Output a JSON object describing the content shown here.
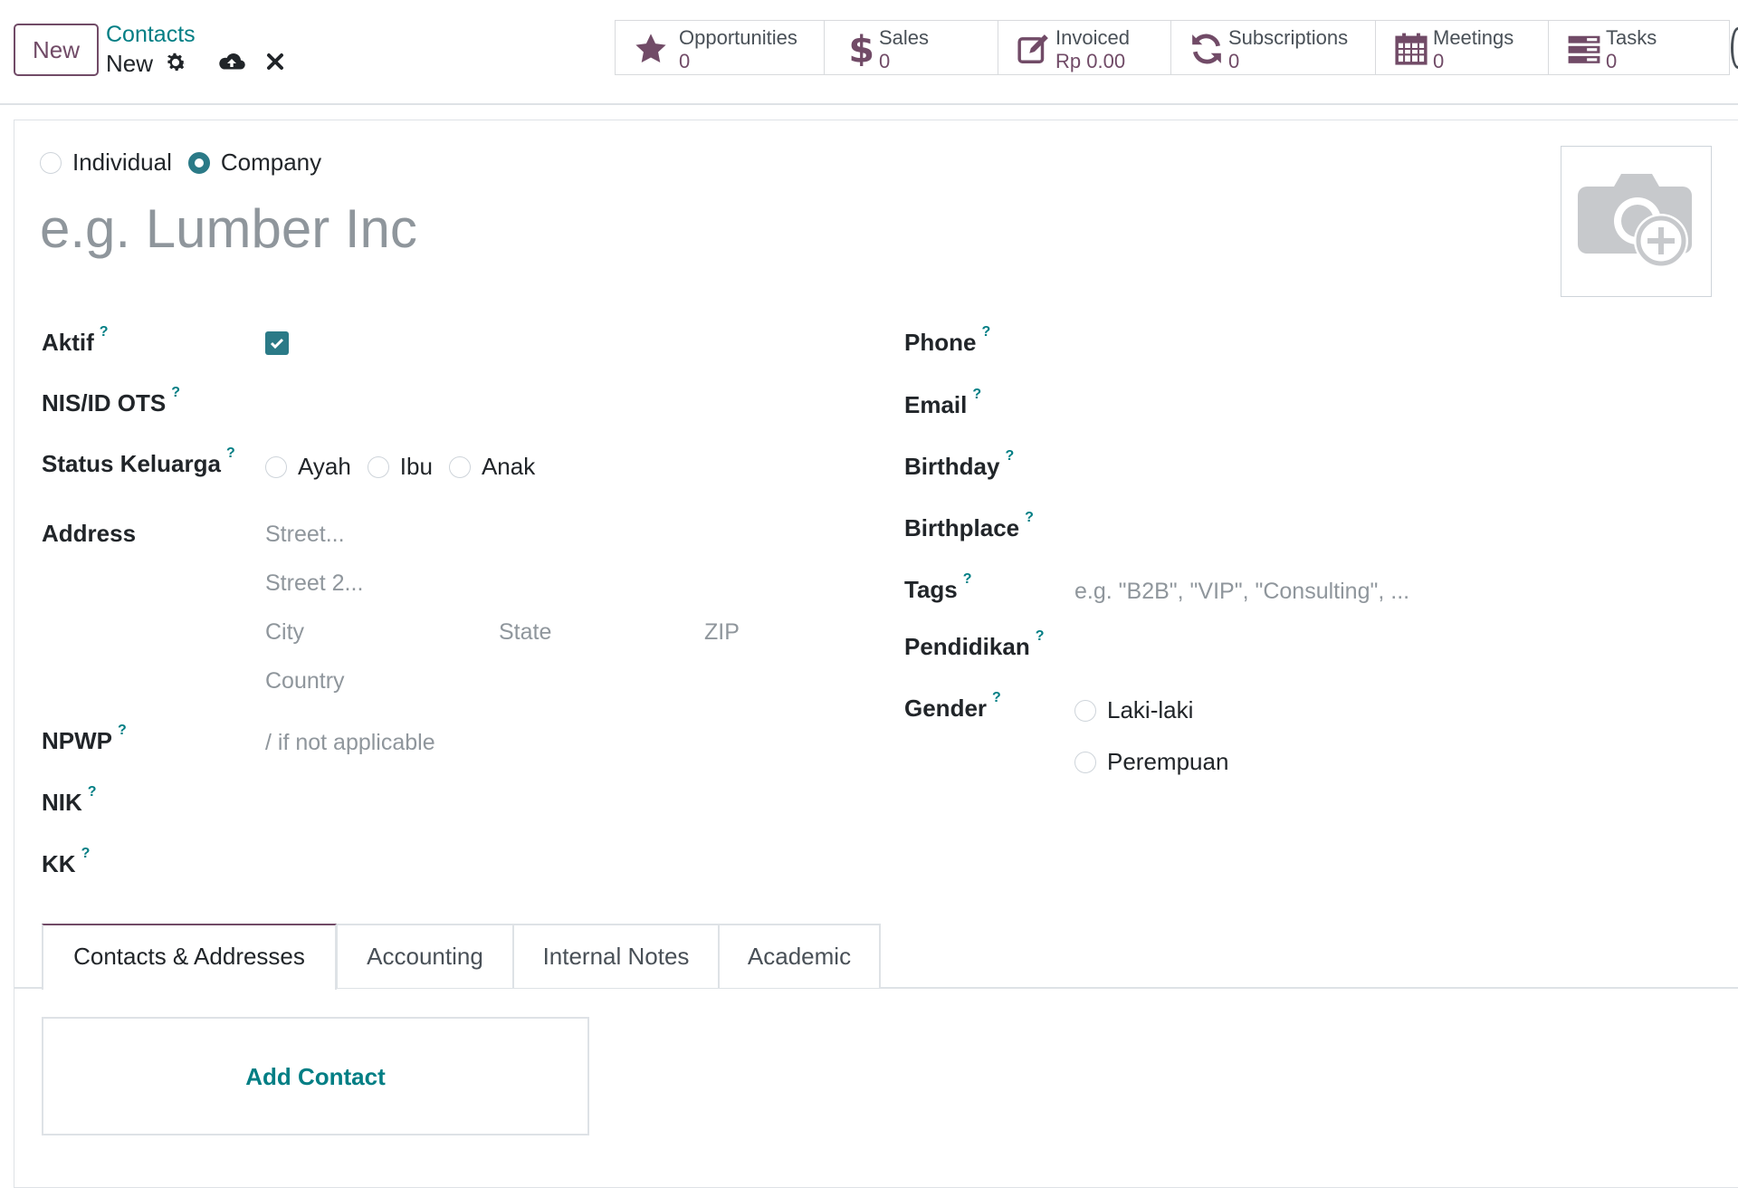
{
  "toolbar": {
    "new_label": "New",
    "breadcrumb_parent": "Contacts",
    "breadcrumb_current": "New"
  },
  "smart_buttons": [
    {
      "title": "Opportunities",
      "value": "0",
      "icon": "star-icon"
    },
    {
      "title": "Sales",
      "value": "0",
      "icon": "dollar-icon"
    },
    {
      "title": "Invoiced",
      "value": "Rp 0.00",
      "icon": "pencil-square-icon"
    },
    {
      "title": "Subscriptions",
      "value": "0",
      "icon": "refresh-icon"
    },
    {
      "title": "Meetings",
      "value": "0",
      "icon": "calendar-icon"
    },
    {
      "title": "Tasks",
      "value": "0",
      "icon": "tasks-icon"
    }
  ],
  "company_type": {
    "options": [
      "Individual",
      "Company"
    ],
    "selected": "Company"
  },
  "name_placeholder": "e.g. Lumber Inc",
  "left_fields": {
    "aktif": {
      "label": "Aktif",
      "help": "?",
      "checked": true
    },
    "nis": {
      "label": "NIS/ID OTS",
      "help": "?"
    },
    "status_keluarga": {
      "label": "Status Keluarga",
      "help": "?",
      "options": [
        "Ayah",
        "Ibu",
        "Anak"
      ]
    },
    "address": {
      "label": "Address",
      "street_ph": "Street...",
      "street2_ph": "Street 2...",
      "city_ph": "City",
      "state_ph": "State",
      "zip_ph": "ZIP",
      "country_ph": "Country"
    },
    "npwp": {
      "label": "NPWP",
      "help": "?",
      "placeholder": "/ if not applicable"
    },
    "nik": {
      "label": "NIK",
      "help": "?"
    },
    "kk": {
      "label": "KK",
      "help": "?"
    }
  },
  "right_fields": {
    "phone": {
      "label": "Phone",
      "help": "?"
    },
    "email": {
      "label": "Email",
      "help": "?"
    },
    "birthday": {
      "label": "Birthday",
      "help": "?"
    },
    "birthplace": {
      "label": "Birthplace",
      "help": "?"
    },
    "tags": {
      "label": "Tags",
      "help": "?",
      "placeholder": "e.g. \"B2B\", \"VIP\", \"Consulting\", ..."
    },
    "pendidikan": {
      "label": "Pendidikan",
      "help": "?"
    },
    "gender": {
      "label": "Gender",
      "help": "?",
      "options": [
        "Laki-laki",
        "Perempuan"
      ]
    }
  },
  "notebook": {
    "tabs": [
      "Contacts & Addresses",
      "Accounting",
      "Internal Notes",
      "Academic"
    ],
    "active": "Contacts & Addresses",
    "add_contact_label": "Add Contact"
  },
  "colors": {
    "brand": "#714b67",
    "link": "#017e84",
    "accent": "#2b7a87"
  }
}
